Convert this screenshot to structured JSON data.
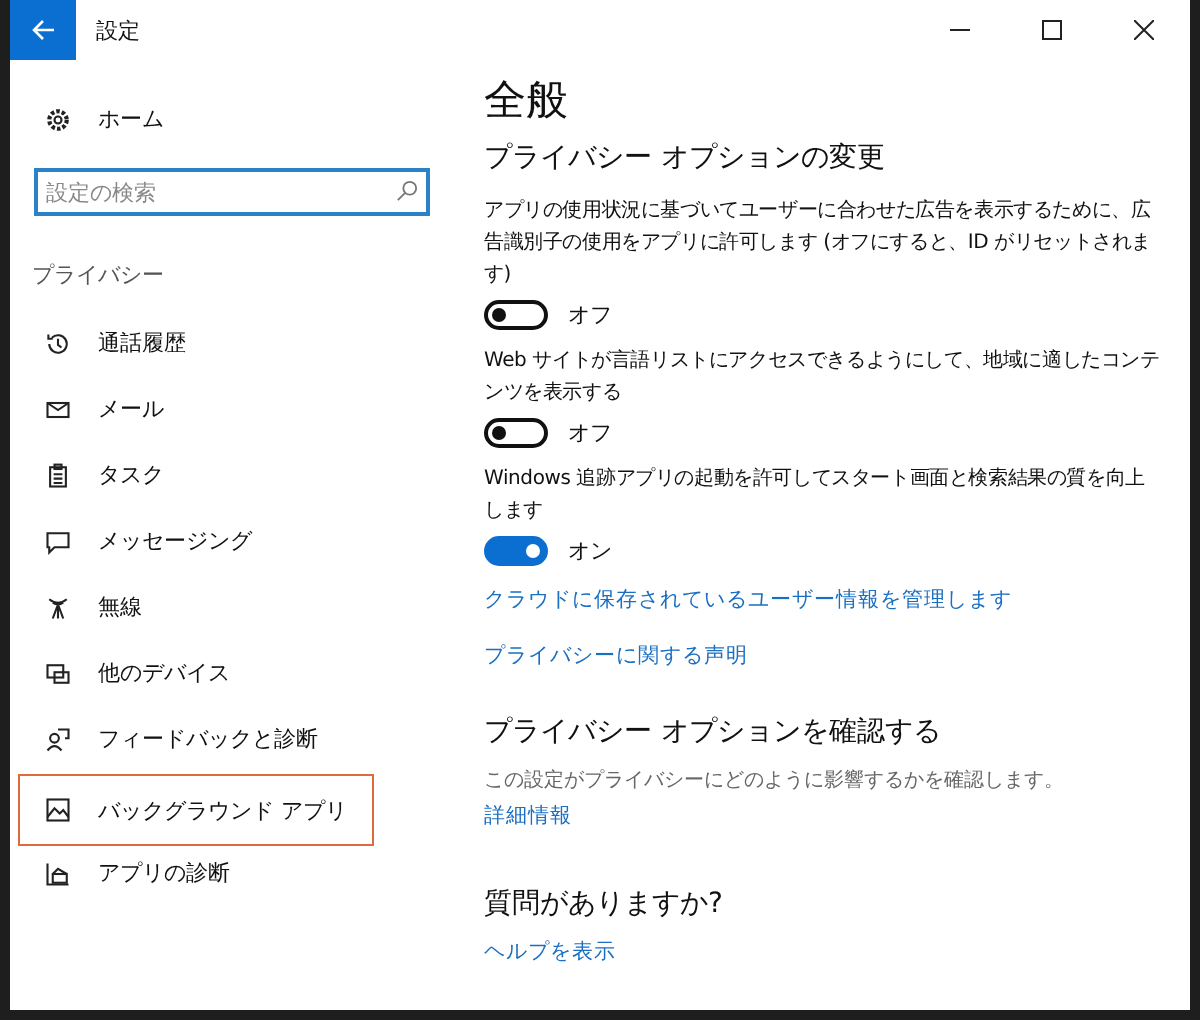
{
  "window": {
    "title": "設定"
  },
  "sidebar": {
    "home": "ホーム",
    "search": {
      "placeholder": "設定の検索"
    },
    "section": "プライバシー",
    "items": [
      {
        "label": "通話履歴",
        "highlighted": false
      },
      {
        "label": "メール",
        "highlighted": false
      },
      {
        "label": "タスク",
        "highlighted": false
      },
      {
        "label": "メッセージング",
        "highlighted": false
      },
      {
        "label": "無線",
        "highlighted": false
      },
      {
        "label": "他のデバイス",
        "highlighted": false
      },
      {
        "label": "フィードバックと診断",
        "highlighted": false
      },
      {
        "label": "バックグラウンド アプリ",
        "highlighted": true
      },
      {
        "label": "アプリの診断",
        "highlighted": false
      }
    ]
  },
  "content": {
    "title": "全般",
    "heading": "プライバシー オプションの変更",
    "options": [
      {
        "description": "アプリの使用状況に基づいてユーザーに合わせた広告を表示するために、広告識別子の使用をアプリに許可します (オフにすると、ID がリセットされます)",
        "on": false,
        "state_label": "オフ"
      },
      {
        "description": "Web サイトが言語リストにアクセスできるようにして、地域に適したコンテンツを表示する",
        "on": false,
        "state_label": "オフ"
      },
      {
        "description": "Windows 追跡アプリの起動を許可してスタート画面と検索結果の質を向上します",
        "on": true,
        "state_label": "オン"
      }
    ],
    "links": [
      "クラウドに保存されているユーザー情報を管理します",
      "プライバシーに関する声明"
    ],
    "review": {
      "heading": "プライバシー オプションを確認する",
      "text": "この設定がプライバシーにどのように影響するかを確認します。",
      "link": "詳細情報"
    },
    "questions": {
      "heading": "質問がありますか?",
      "link": "ヘルプを表示"
    }
  }
}
